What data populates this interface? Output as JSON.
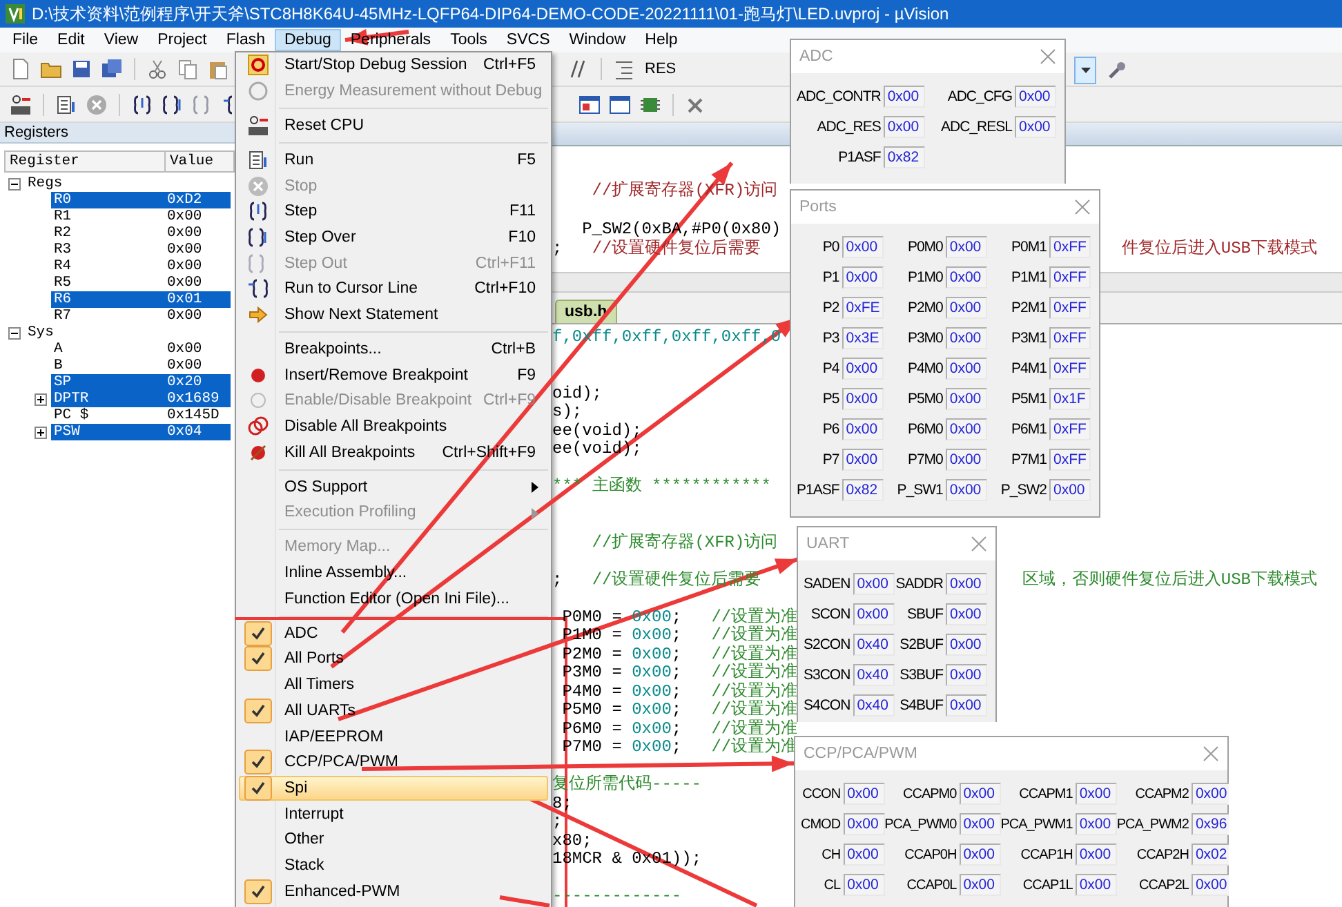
{
  "window": {
    "title": "D:\\技术资料\\范例程序\\开天斧\\STC8H8K64U-45MHz-LQFP64-DIP64-DEMO-CODE-20221111\\01-跑马灯\\LED.uvproj - µVision"
  },
  "menu_bar": [
    {
      "label": "File",
      "selected": false
    },
    {
      "label": "Edit",
      "selected": false
    },
    {
      "label": "View",
      "selected": false
    },
    {
      "label": "Project",
      "selected": false
    },
    {
      "label": "Flash",
      "selected": false
    },
    {
      "label": "Debug",
      "selected": true
    },
    {
      "label": "Peripherals",
      "selected": false
    },
    {
      "label": "Tools",
      "selected": false
    },
    {
      "label": "SVCS",
      "selected": false
    },
    {
      "label": "Window",
      "selected": false
    },
    {
      "label": "Help",
      "selected": false
    }
  ],
  "toolbar": {
    "label": "RES"
  },
  "registers": {
    "title": "Registers",
    "columns": [
      "Register",
      "Value"
    ],
    "groups": [
      {
        "name": "Regs",
        "expanded": true,
        "children": [
          {
            "name": "R0",
            "value": "0xD2",
            "selected": true
          },
          {
            "name": "R1",
            "value": "0x00",
            "selected": false
          },
          {
            "name": "R2",
            "value": "0x00",
            "selected": false
          },
          {
            "name": "R3",
            "value": "0x00",
            "selected": false
          },
          {
            "name": "R4",
            "value": "0x00",
            "selected": false
          },
          {
            "name": "R5",
            "value": "0x00",
            "selected": false
          },
          {
            "name": "R6",
            "value": "0x01",
            "selected": true
          },
          {
            "name": "R7",
            "value": "0x00",
            "selected": false
          }
        ]
      },
      {
        "name": "Sys",
        "expanded": true,
        "children": [
          {
            "name": "A",
            "value": "0x00",
            "selected": false
          },
          {
            "name": "B",
            "value": "0x00",
            "selected": false
          },
          {
            "name": "SP",
            "value": "0x20",
            "selected": true
          },
          {
            "name": "DPTR",
            "value": "0x1689",
            "selected": true,
            "expanded": false
          },
          {
            "name": "PC $",
            "value": "0x145D",
            "selected": false
          },
          {
            "name": "PSW",
            "value": "0x04",
            "selected": true,
            "expanded": false
          }
        ]
      }
    ]
  },
  "editor": {
    "upper": [
      {
        "kind": "code",
        "segments": [
          {
            "text": "    //扩展寄存器(XFR)访问",
            "kind": "remark"
          }
        ]
      },
      {
        "kind": "blank"
      },
      {
        "kind": "code",
        "segments": [
          {
            "text": "   P_SW2(0xBA,#P0(0x80)",
            "kind": "code"
          }
        ]
      },
      {
        "kind": "code",
        "segments": [
          {
            "text": ";   ",
            "kind": "code"
          },
          {
            "text": "//设置硬件复位后需要",
            "kind": "remark"
          }
        ],
        "tail": [
          {
            "text": "件复位后进入USB下载模式",
            "kind": "remark"
          }
        ]
      }
    ],
    "tab": "usb.h",
    "lower": [
      {
        "kind": "code",
        "segments": [
          {
            "text": "f,0xff,0xff,0xff,0xff,0",
            "kind": "number"
          }
        ]
      },
      {
        "kind": "blank"
      },
      {
        "kind": "blank"
      },
      {
        "kind": "code",
        "segments": [
          {
            "text": "oid);",
            "kind": "code"
          }
        ]
      },
      {
        "kind": "code",
        "segments": [
          {
            "text": "s);",
            "kind": "code"
          }
        ]
      },
      {
        "kind": "code",
        "segments": [
          {
            "text": "ee(void);",
            "kind": "code"
          }
        ]
      },
      {
        "kind": "code",
        "segments": [
          {
            "text": "ee(void);",
            "kind": "code"
          }
        ]
      },
      {
        "kind": "blank"
      },
      {
        "kind": "code",
        "segments": [
          {
            "text": "*** 主函数 ************",
            "kind": "comment"
          }
        ]
      },
      {
        "kind": "blank"
      },
      {
        "kind": "blank"
      },
      {
        "kind": "code",
        "segments": [
          {
            "text": "    //扩展寄存器(XFR)访问",
            "kind": "comment"
          }
        ]
      },
      {
        "kind": "blank"
      },
      {
        "kind": "code",
        "segments": [
          {
            "text": ";   ",
            "kind": "code"
          },
          {
            "text": "//设置硬件复位后需要",
            "kind": "comment"
          }
        ],
        "tail": [
          {
            "text": "区域，否则硬件复位后进入USB下载模式",
            "kind": "comment"
          }
        ]
      },
      {
        "kind": "blank"
      },
      {
        "kind": "code",
        "segments": [
          {
            "text": " P0M0 = ",
            "kind": "code"
          },
          {
            "text": "0x00",
            "kind": "number"
          },
          {
            "text": ";   ",
            "kind": "code"
          },
          {
            "text": "//设置为准",
            "kind": "comment"
          }
        ]
      },
      {
        "kind": "code",
        "segments": [
          {
            "text": " P1M0 = ",
            "kind": "code"
          },
          {
            "text": "0x00",
            "kind": "number"
          },
          {
            "text": ";   ",
            "kind": "code"
          },
          {
            "text": "//设置为准",
            "kind": "comment"
          }
        ]
      },
      {
        "kind": "code",
        "segments": [
          {
            "text": " P2M0 = ",
            "kind": "code"
          },
          {
            "text": "0x00",
            "kind": "number"
          },
          {
            "text": ";   ",
            "kind": "code"
          },
          {
            "text": "//设置为准",
            "kind": "comment"
          }
        ]
      },
      {
        "kind": "code",
        "segments": [
          {
            "text": " P3M0 = ",
            "kind": "code"
          },
          {
            "text": "0x00",
            "kind": "number"
          },
          {
            "text": ";   ",
            "kind": "code"
          },
          {
            "text": "//设置为准",
            "kind": "comment"
          }
        ]
      },
      {
        "kind": "code",
        "segments": [
          {
            "text": " P4M0 = ",
            "kind": "code"
          },
          {
            "text": "0x00",
            "kind": "number"
          },
          {
            "text": ";   ",
            "kind": "code"
          },
          {
            "text": "//设置为准",
            "kind": "comment"
          }
        ]
      },
      {
        "kind": "code",
        "segments": [
          {
            "text": " P5M0 = ",
            "kind": "code"
          },
          {
            "text": "0x00",
            "kind": "number"
          },
          {
            "text": ";   ",
            "kind": "code"
          },
          {
            "text": "//设置为准",
            "kind": "comment"
          }
        ]
      },
      {
        "kind": "code",
        "segments": [
          {
            "text": " P6M0 = ",
            "kind": "code"
          },
          {
            "text": "0x00",
            "kind": "number"
          },
          {
            "text": ";   ",
            "kind": "code"
          },
          {
            "text": "//设置为准",
            "kind": "comment"
          }
        ]
      },
      {
        "kind": "code",
        "segments": [
          {
            "text": " P7M0 = ",
            "kind": "code"
          },
          {
            "text": "0x00",
            "kind": "number"
          },
          {
            "text": ";   ",
            "kind": "code"
          },
          {
            "text": "//设置为准",
            "kind": "comment"
          }
        ]
      },
      {
        "kind": "blank"
      },
      {
        "kind": "code",
        "segments": [
          {
            "text": "复位所需代码-----",
            "kind": "comment"
          }
        ]
      },
      {
        "kind": "code",
        "segments": [
          {
            "text": "8;",
            "kind": "code"
          }
        ]
      },
      {
        "kind": "code",
        "segments": [
          {
            "text": ";",
            "kind": "code"
          }
        ]
      },
      {
        "kind": "code",
        "segments": [
          {
            "text": "x80;",
            "kind": "code"
          }
        ]
      },
      {
        "kind": "code",
        "segments": [
          {
            "text": "18MCR & 0x01));",
            "kind": "code"
          }
        ]
      },
      {
        "kind": "blank"
      },
      {
        "kind": "code",
        "segments": [
          {
            "text": "-------------",
            "kind": "comment"
          }
        ]
      }
    ]
  },
  "debug_menu": [
    {
      "kind": "item",
      "label": "Start/Stop Debug Session",
      "shortcut": "Ctrl+F5",
      "disabled": false,
      "checked": false,
      "selected": false,
      "submenu": false
    },
    {
      "kind": "item",
      "label": "Energy Measurement without Debug",
      "disabled": true,
      "checked": false,
      "selected": false,
      "submenu": false
    },
    {
      "kind": "separator"
    },
    {
      "kind": "item",
      "label": "Reset CPU",
      "disabled": false,
      "checked": false,
      "selected": false,
      "submenu": false
    },
    {
      "kind": "separator"
    },
    {
      "kind": "item",
      "label": "Run",
      "shortcut": "F5",
      "disabled": false,
      "checked": false,
      "selected": false,
      "submenu": false
    },
    {
      "kind": "item",
      "label": "Stop",
      "disabled": true,
      "checked": false,
      "selected": false,
      "submenu": false
    },
    {
      "kind": "item",
      "label": "Step",
      "shortcut": "F11",
      "disabled": false,
      "checked": false,
      "selected": false,
      "submenu": false
    },
    {
      "kind": "item",
      "label": "Step Over",
      "shortcut": "F10",
      "disabled": false,
      "checked": false,
      "selected": false,
      "submenu": false
    },
    {
      "kind": "item",
      "label": "Step Out",
      "shortcut": "Ctrl+F11",
      "disabled": true,
      "checked": false,
      "selected": false,
      "submenu": false
    },
    {
      "kind": "item",
      "label": "Run to Cursor Line",
      "shortcut": "Ctrl+F10",
      "disabled": false,
      "checked": false,
      "selected": false,
      "submenu": false
    },
    {
      "kind": "item",
      "label": "Show Next Statement",
      "disabled": false,
      "checked": false,
      "selected": false,
      "submenu": false
    },
    {
      "kind": "separator"
    },
    {
      "kind": "item",
      "label": "Breakpoints...",
      "shortcut": "Ctrl+B",
      "disabled": false,
      "checked": false,
      "selected": false,
      "submenu": false
    },
    {
      "kind": "item",
      "label": "Insert/Remove Breakpoint",
      "shortcut": "F9",
      "disabled": false,
      "checked": false,
      "selected": false,
      "submenu": false
    },
    {
      "kind": "item",
      "label": "Enable/Disable Breakpoint",
      "shortcut": "Ctrl+F9",
      "disabled": true,
      "checked": false,
      "selected": false,
      "submenu": false
    },
    {
      "kind": "item",
      "label": "Disable All Breakpoints",
      "disabled": false,
      "checked": false,
      "selected": false,
      "submenu": false
    },
    {
      "kind": "item",
      "label": "Kill All Breakpoints",
      "shortcut": "Ctrl+Shift+F9",
      "disabled": false,
      "checked": false,
      "selected": false,
      "submenu": false
    },
    {
      "kind": "separator"
    },
    {
      "kind": "item",
      "label": "OS Support",
      "disabled": false,
      "checked": false,
      "selected": false,
      "submenu": true
    },
    {
      "kind": "item",
      "label": "Execution Profiling",
      "disabled": true,
      "checked": false,
      "selected": false,
      "submenu": true
    },
    {
      "kind": "separator"
    },
    {
      "kind": "item",
      "label": "Memory Map...",
      "disabled": true,
      "checked": false,
      "selected": false,
      "submenu": false
    },
    {
      "kind": "item",
      "label": "Inline Assembly...",
      "disabled": false,
      "checked": false,
      "selected": false,
      "submenu": false
    },
    {
      "kind": "item",
      "label": "Function Editor (Open Ini File)...",
      "disabled": false,
      "checked": false,
      "selected": false,
      "submenu": false
    },
    {
      "kind": "separator"
    },
    {
      "kind": "item",
      "label": "ADC",
      "disabled": false,
      "checked": true,
      "selected": false,
      "submenu": false
    },
    {
      "kind": "item",
      "label": "All Ports",
      "disabled": false,
      "checked": true,
      "selected": false,
      "submenu": false
    },
    {
      "kind": "item",
      "label": "All Timers",
      "disabled": false,
      "checked": false,
      "selected": false,
      "submenu": false
    },
    {
      "kind": "item",
      "label": "All UARTs",
      "disabled": false,
      "checked": true,
      "selected": false,
      "submenu": false
    },
    {
      "kind": "item",
      "label": "IAP/EEPROM",
      "disabled": false,
      "checked": false,
      "selected": false,
      "submenu": false
    },
    {
      "kind": "item",
      "label": "CCP/PCA/PWM",
      "disabled": false,
      "checked": true,
      "selected": false,
      "submenu": false
    },
    {
      "kind": "item",
      "label": "Spi",
      "disabled": false,
      "checked": true,
      "selected": true,
      "submenu": false
    },
    {
      "kind": "item",
      "label": "Interrupt",
      "disabled": false,
      "checked": false,
      "selected": false,
      "submenu": false
    },
    {
      "kind": "item",
      "label": "Other",
      "disabled": false,
      "checked": false,
      "selected": false,
      "submenu": false
    },
    {
      "kind": "item",
      "label": "Stack",
      "disabled": false,
      "checked": false,
      "selected": false,
      "submenu": false
    },
    {
      "kind": "item",
      "label": "Enhanced-PWM",
      "disabled": false,
      "checked": true,
      "selected": false,
      "submenu": false
    }
  ],
  "peripheral_windows": [
    {
      "title": "ADC",
      "rows": [
        [
          {
            "label": "ADC_CONTR",
            "value": "0x00"
          },
          {
            "label": "ADC_CFG",
            "value": "0x00"
          }
        ],
        [
          {
            "label": "ADC_RES",
            "value": "0x00"
          },
          {
            "label": "ADC_RESL",
            "value": "0x00"
          }
        ],
        [
          {
            "label": "P1ASF",
            "value": "0x82"
          }
        ]
      ]
    },
    {
      "title": "Ports",
      "rows": [
        [
          {
            "label": "P0",
            "value": "0x00"
          },
          {
            "label": "P0M0",
            "value": "0x00"
          },
          {
            "label": "P0M1",
            "value": "0xFF"
          }
        ],
        [
          {
            "label": "P1",
            "value": "0x00"
          },
          {
            "label": "P1M0",
            "value": "0x00"
          },
          {
            "label": "P1M1",
            "value": "0xFF"
          }
        ],
        [
          {
            "label": "P2",
            "value": "0xFE"
          },
          {
            "label": "P2M0",
            "value": "0x00"
          },
          {
            "label": "P2M1",
            "value": "0xFF"
          }
        ],
        [
          {
            "label": "P3",
            "value": "0x3E"
          },
          {
            "label": "P3M0",
            "value": "0x00"
          },
          {
            "label": "P3M1",
            "value": "0xFF"
          }
        ],
        [
          {
            "label": "P4",
            "value": "0x00"
          },
          {
            "label": "P4M0",
            "value": "0x00"
          },
          {
            "label": "P4M1",
            "value": "0xFF"
          }
        ],
        [
          {
            "label": "P5",
            "value": "0x00"
          },
          {
            "label": "P5M0",
            "value": "0x00"
          },
          {
            "label": "P5M1",
            "value": "0x1F"
          }
        ],
        [
          {
            "label": "P6",
            "value": "0x00"
          },
          {
            "label": "P6M0",
            "value": "0x00"
          },
          {
            "label": "P6M1",
            "value": "0xFF"
          }
        ],
        [
          {
            "label": "P7",
            "value": "0x00"
          },
          {
            "label": "P7M0",
            "value": "0x00"
          },
          {
            "label": "P7M1",
            "value": "0xFF"
          }
        ],
        [
          {
            "label": "P1ASF",
            "value": "0x82"
          },
          {
            "label": "P_SW1",
            "value": "0x00"
          },
          {
            "label": "P_SW2",
            "value": "0x00"
          }
        ]
      ]
    },
    {
      "title": "UART",
      "rows": [
        [
          {
            "label": "SADEN",
            "value": "0x00"
          },
          {
            "label": "SADDR",
            "value": "0x00"
          }
        ],
        [
          {
            "label": "SCON",
            "value": "0x00"
          },
          {
            "label": "SBUF",
            "value": "0x00"
          }
        ],
        [
          {
            "label": "S2CON",
            "value": "0x40"
          },
          {
            "label": "S2BUF",
            "value": "0x00"
          }
        ],
        [
          {
            "label": "S3CON",
            "value": "0x40"
          },
          {
            "label": "S3BUF",
            "value": "0x00"
          }
        ],
        [
          {
            "label": "S4CON",
            "value": "0x40"
          },
          {
            "label": "S4BUF",
            "value": "0x00"
          }
        ]
      ]
    },
    {
      "title": "CCP/PCA/PWM",
      "rows": [
        [
          {
            "label": "CCON",
            "value": "0x00"
          },
          {
            "label": "CCAPM0",
            "value": "0x00"
          },
          {
            "label": "CCAPM1",
            "value": "0x00"
          },
          {
            "label": "CCAPM2",
            "value": "0x00"
          }
        ],
        [
          {
            "label": "CMOD",
            "value": "0x00"
          },
          {
            "label": "PCA_PWM0",
            "value": "0x00"
          },
          {
            "label": "PCA_PWM1",
            "value": "0x00"
          },
          {
            "label": "PCA_PWM2",
            "value": "0x96"
          }
        ],
        [
          {
            "label": "CH",
            "value": "0x00"
          },
          {
            "label": "CCAP0H",
            "value": "0x00"
          },
          {
            "label": "CCAP1H",
            "value": "0x00"
          },
          {
            "label": "CCAP2H",
            "value": "0x02"
          }
        ],
        [
          {
            "label": "CL",
            "value": "0x00"
          },
          {
            "label": "CCAP0L",
            "value": "0x00"
          },
          {
            "label": "CCAP1L",
            "value": "0x00"
          },
          {
            "label": "CCAP2L",
            "value": "0x00"
          }
        ]
      ]
    }
  ]
}
